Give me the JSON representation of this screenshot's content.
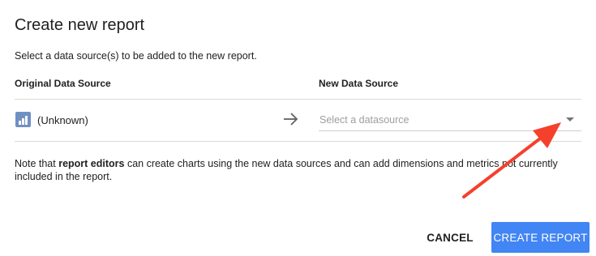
{
  "dialog": {
    "title": "Create new report",
    "subtitle": "Select a data source(s) to be added to the new report."
  },
  "columns": {
    "original": "Original Data Source",
    "new": "New Data Source"
  },
  "row": {
    "source_name": "(Unknown)",
    "source_icon": "report-chart-icon",
    "arrow_icon": "arrow-right-icon",
    "datasource_placeholder": "Select a datasource",
    "caret_icon": "dropdown-caret-icon"
  },
  "note": {
    "prefix": "Note that ",
    "bold": "report editors",
    "suffix": " can create charts using the new data sources and can add dimensions and metrics not currently included in the report."
  },
  "actions": {
    "cancel": "CANCEL",
    "create": "CREATE REPORT"
  },
  "colors": {
    "primary": "#4285f4",
    "annotation_arrow": "#f5402c",
    "source_icon": "#6f90c2"
  }
}
